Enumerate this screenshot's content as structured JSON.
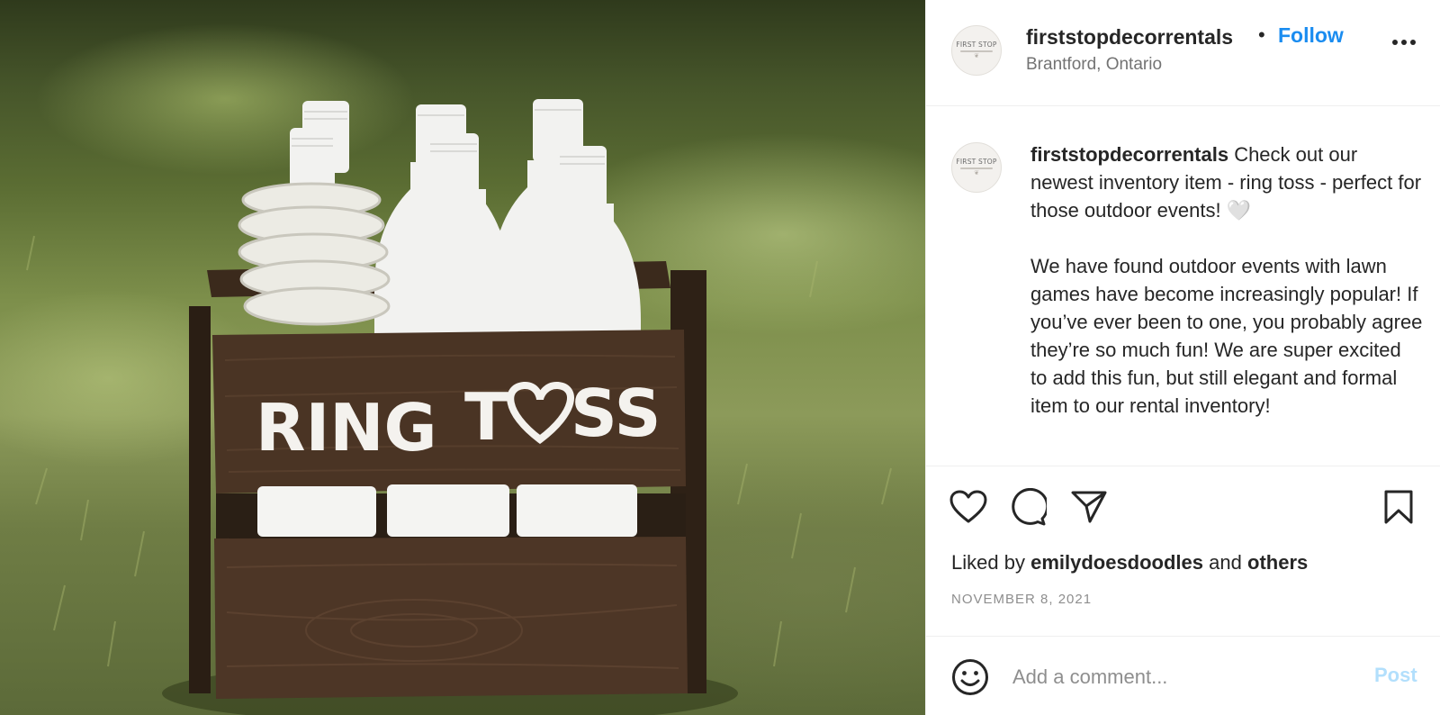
{
  "post": {
    "username": "firststopdecorrentals",
    "location": "Brantford, Ontario",
    "follow_label": "Follow",
    "separator": "•",
    "avatar_text": "FIRST STOP",
    "photo_sign_text": [
      "RING",
      "T",
      "SS"
    ],
    "caption": {
      "username": "firststopdecorrentals",
      "paragraph_1": "Check out our newest inventory item - ring toss - perfect for those outdoor events! 🤍",
      "paragraph_2": "We have found outdoor events with lawn games have become increasingly popular! If you’ve ever been to one, you probably agree they’re so much fun! We are super excited to add this fun, but still elegant and formal item to our rental inventory!"
    },
    "likes": {
      "prefix": "Liked by",
      "user": "emilydoesdoodles",
      "joiner": "and",
      "others": "others"
    },
    "date": "NOVEMBER 8, 2021",
    "comment": {
      "placeholder": "Add a comment...",
      "post_label": "Post"
    },
    "icons": {
      "more": "more-options-icon",
      "like": "heart-icon",
      "comment": "comment-icon",
      "share": "paper-plane-icon",
      "save": "bookmark-icon",
      "emoji": "smiley-icon"
    },
    "colors": {
      "follow": "#1a8cf0",
      "post_disabled": "#b2dffc",
      "date": "#8e8e8e",
      "location": "#737373"
    }
  }
}
